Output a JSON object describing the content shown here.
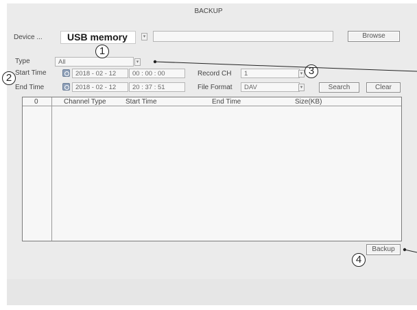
{
  "dialog": {
    "title": "BACKUP"
  },
  "device": {
    "label": "Device ...",
    "value": "USB memory",
    "dropdown_glyph": "▾",
    "browse_label": "Browse"
  },
  "type": {
    "label": "Type",
    "value": "All"
  },
  "start_time": {
    "label": "Start Time",
    "date": "2018 - 02 - 12",
    "time": "00 : 00 : 00"
  },
  "end_time": {
    "label": "End Time",
    "date": "2018 - 02 - 12",
    "time": "20 : 37 : 51"
  },
  "record_ch": {
    "label": "Record CH",
    "value": "1"
  },
  "file_format": {
    "label": "File Format",
    "value": "DAV"
  },
  "buttons": {
    "search": "Search",
    "clear": "Clear",
    "backup": "Backup"
  },
  "table": {
    "columns": [
      "0",
      "Channel Type",
      "Start Time",
      "End Time",
      "Size(KB)"
    ],
    "rows": []
  },
  "callouts": [
    "1",
    "2",
    "3",
    "4"
  ],
  "icons": {
    "clock": "clock-icon",
    "dropdown": "chevron-down-icon"
  }
}
